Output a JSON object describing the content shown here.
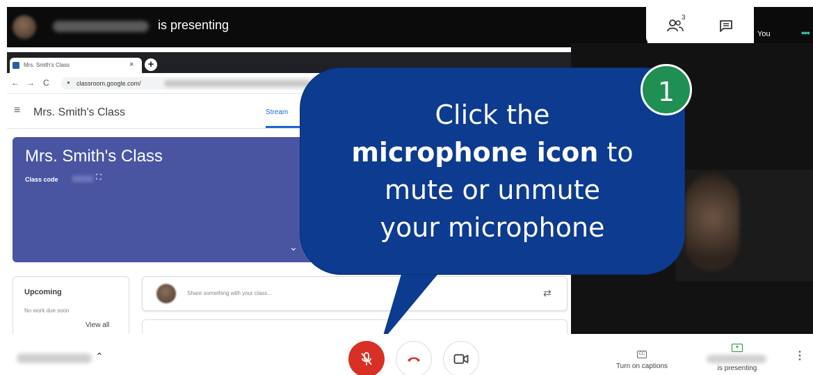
{
  "presenting_bar": {
    "label": "is presenting"
  },
  "top_controls": {
    "people_count": "3",
    "you_label": "You",
    "more_dots": "•••"
  },
  "shared_screen": {
    "tab_title": "Mrs. Smith's Class",
    "tab_close": "×",
    "new_tab": "+",
    "url": "classroom.google.com/",
    "class_title": "Mrs. Smith's Class",
    "stream_tab": "Stream",
    "banner_title": "Mrs. Smith's Class",
    "class_code_label": "Class code",
    "upcoming_title": "Upcoming",
    "upcoming_none": "No work due soon",
    "view_all": "View all",
    "share_placeholder": "Share something with your class..."
  },
  "callout": {
    "line1": "Click the",
    "line2_bold": "microphone icon",
    "line2_rest": " to",
    "line3": "mute or unmute",
    "line4": "your microphone",
    "step_number": "1"
  },
  "bottom_bar": {
    "captions_label": "Turn on captions",
    "cc_glyph": "CC",
    "present_label": "is presenting",
    "mic_state": "muted"
  },
  "colors": {
    "callout": "#0d3b8f",
    "badge": "#1f8f54",
    "mic_button": "#d93025",
    "banner": "#4a55a2"
  }
}
